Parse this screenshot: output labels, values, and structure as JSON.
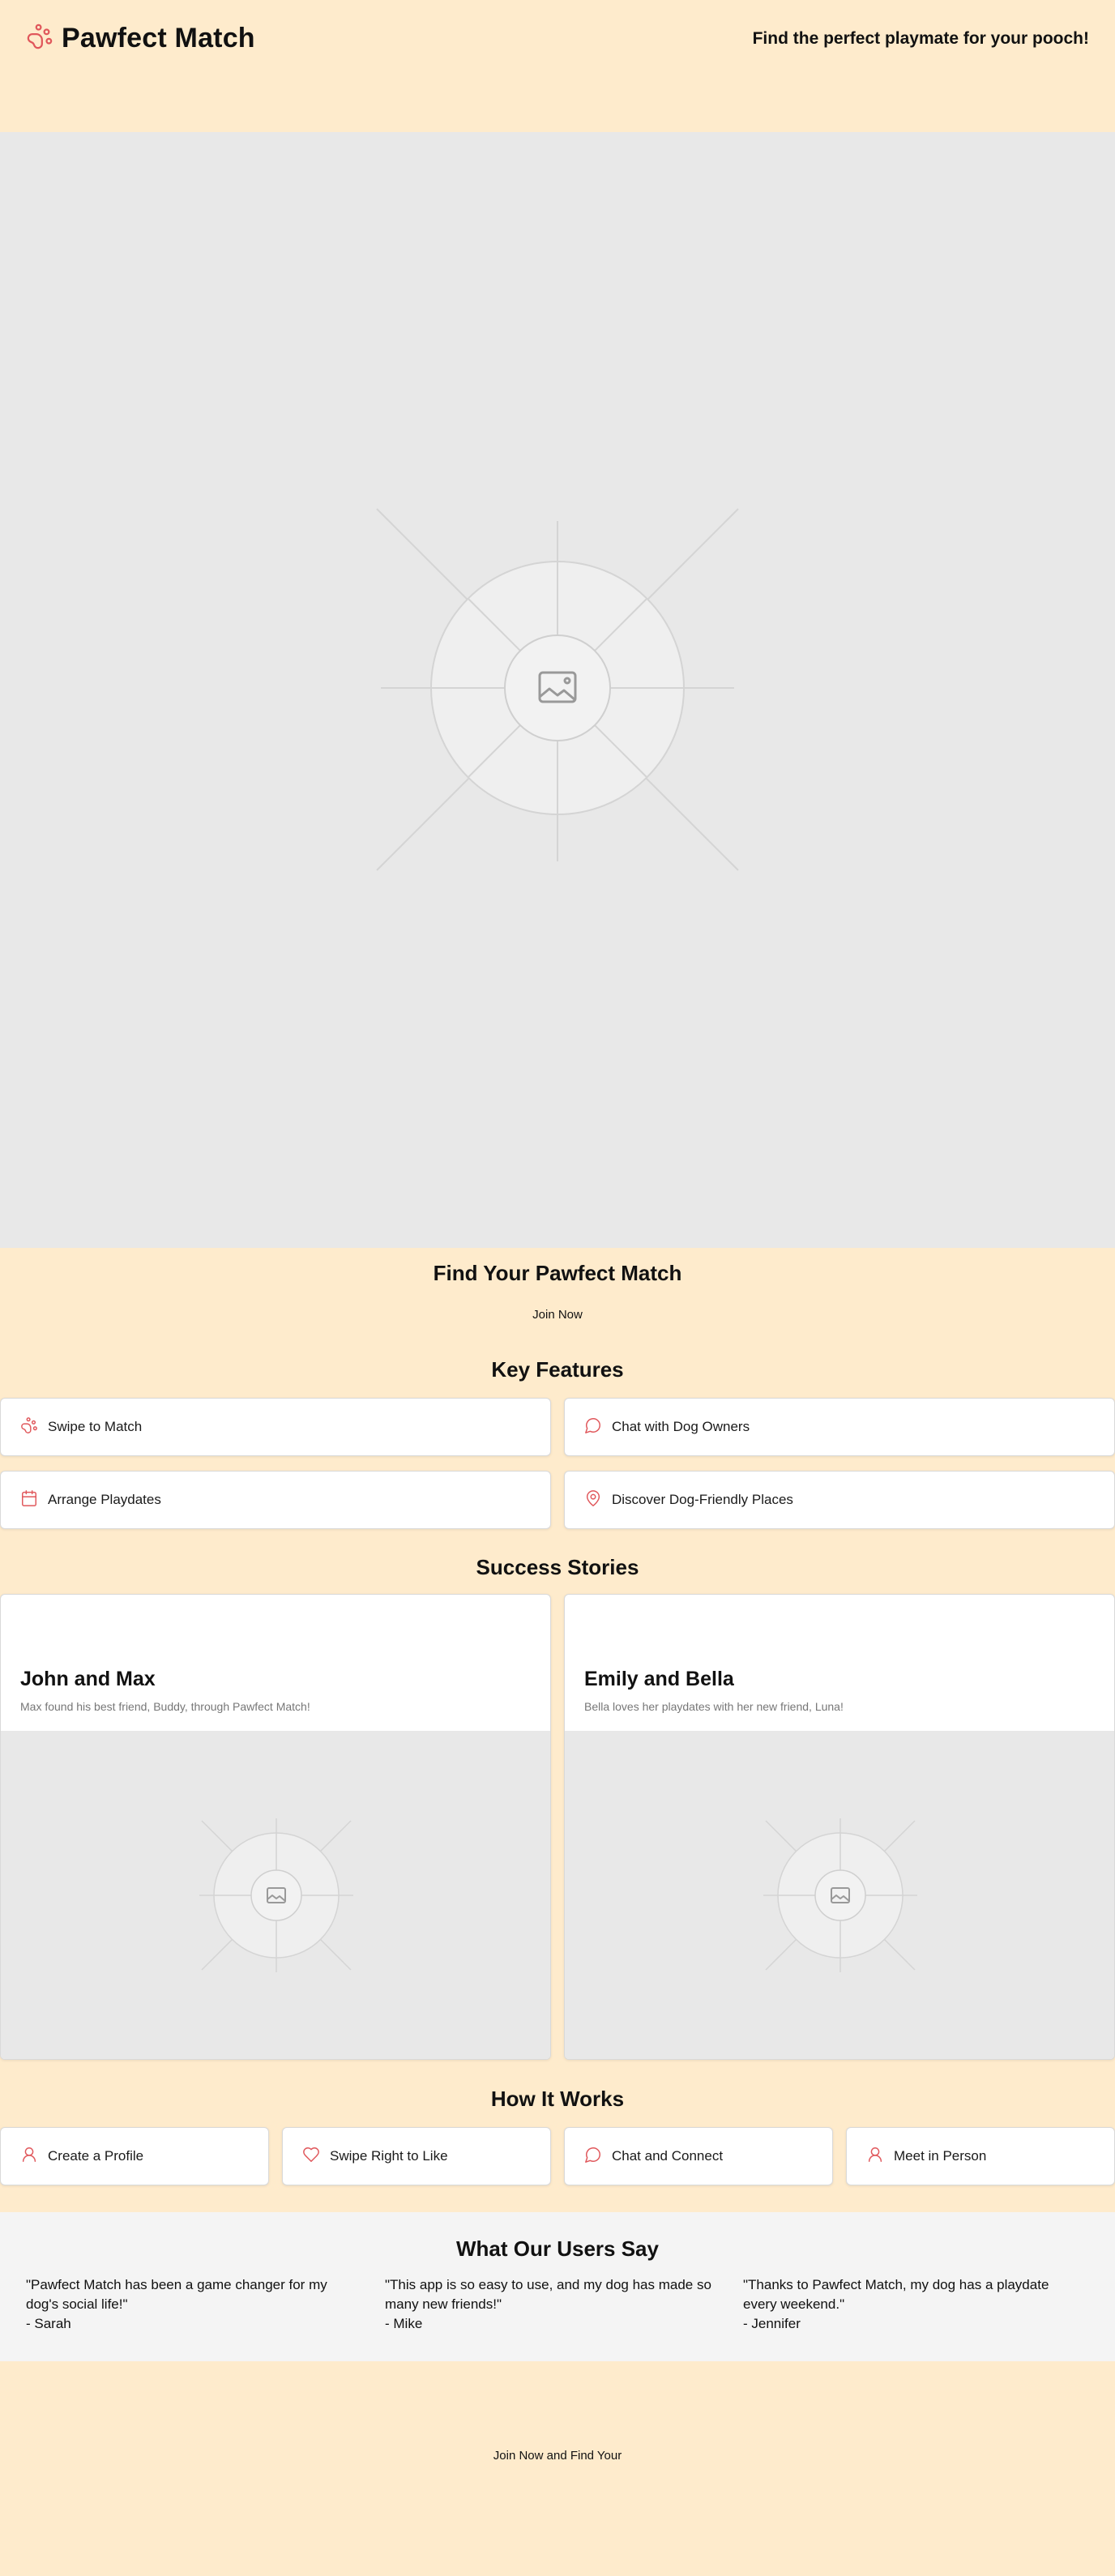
{
  "header": {
    "brand_title": "Pawfect Match",
    "tagline": "Find the perfect playmate for your pooch!"
  },
  "hero": {
    "title": "Find Your Pawfect Match",
    "cta": "Join Now"
  },
  "features": {
    "title": "Key Features",
    "items": [
      {
        "label": "Swipe to Match",
        "icon": "paw-icon"
      },
      {
        "label": "Chat with Dog Owners",
        "icon": "chat-icon"
      },
      {
        "label": "Arrange Playdates",
        "icon": "calendar-icon"
      },
      {
        "label": "Discover Dog-Friendly Places",
        "icon": "map-pin-icon"
      }
    ]
  },
  "stories": {
    "title": "Success Stories",
    "items": [
      {
        "name": "John and Max",
        "desc": "Max found his best friend, Buddy, through Pawfect Match!"
      },
      {
        "name": "Emily and Bella",
        "desc": "Bella loves her playdates with her new friend, Luna!"
      }
    ]
  },
  "how": {
    "title": "How It Works",
    "steps": [
      {
        "label": "Create a Profile",
        "icon": "user-icon"
      },
      {
        "label": "Swipe Right to Like",
        "icon": "heart-icon"
      },
      {
        "label": "Chat and Connect",
        "icon": "chat-icon"
      },
      {
        "label": "Meet in Person",
        "icon": "user-icon"
      }
    ]
  },
  "testimonials": {
    "title": "What Our Users Say",
    "items": [
      {
        "quote": "\"Pawfect Match has been a game changer for my dog's social life!\"",
        "author": "- Sarah"
      },
      {
        "quote": "\"This app is so easy to use, and my dog has made so many new friends!\"",
        "author": "- Mike"
      },
      {
        "quote": "\"Thanks to Pawfect Match, my dog has a playdate every weekend.\"",
        "author": "- Jennifer"
      }
    ]
  },
  "footer": {
    "cta": "Join Now and Find Your"
  },
  "colors": {
    "background": "#feebcc",
    "accent": "#e0575b",
    "placeholder": "#e8e8e8",
    "testimonial_bg": "#f4f4f4"
  }
}
